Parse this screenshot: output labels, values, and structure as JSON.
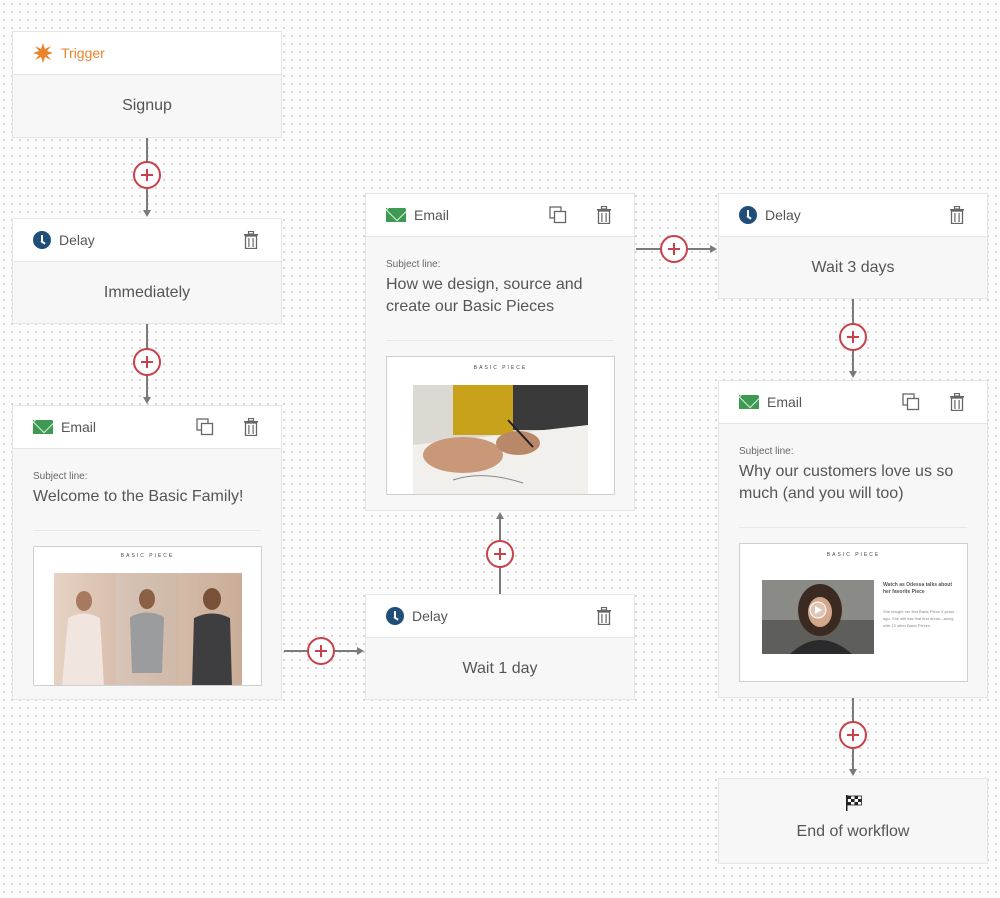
{
  "colors": {
    "plus": "#c8404a",
    "trigger": "#e8862e",
    "clock": "#1f4f78",
    "email_icon": "#3e9a52"
  },
  "trigger": {
    "title": "Trigger",
    "body": "Signup",
    "icon": "starburst-icon"
  },
  "delay1": {
    "title": "Delay",
    "body": "Immediately",
    "icon": "clock-icon"
  },
  "email1": {
    "title": "Email",
    "subject_label": "Subject line:",
    "subject": "Welcome to the Basic Family!",
    "preview_brand": "BASIC PIECE"
  },
  "delay2": {
    "title": "Delay",
    "body": "Wait 1 day"
  },
  "email2": {
    "title": "Email",
    "subject_label": "Subject line:",
    "subject": "How we design, source and create our Basic Pieces",
    "preview_brand": "BASIC PIECE"
  },
  "delay3": {
    "title": "Delay",
    "body": "Wait 3 days"
  },
  "email3": {
    "title": "Email",
    "subject_label": "Subject line:",
    "subject": "Why our customers love us so much (and you will too)",
    "preview_brand": "BASIC PIECE",
    "preview_heading": "Watch as Odessa talks about her favorite Piece",
    "preview_body": "She bought her first Basic Piece 3 years ago. She still has that first dress—along with 13 other Basic Pieces."
  },
  "end": {
    "label": "End of workflow",
    "icon": "checkered-flag-icon"
  }
}
